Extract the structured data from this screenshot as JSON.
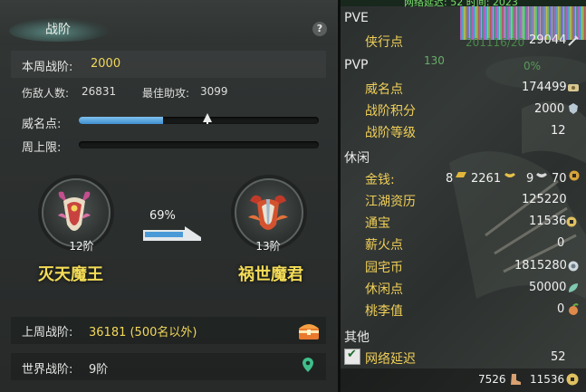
{
  "left_panel": {
    "title": "战阶",
    "help": "?",
    "week_rank_label": "本周战阶:",
    "week_rank_value": "2000",
    "kills_label": "伤敌人数:",
    "kills_value": "26831",
    "assist_label": "最佳助攻:",
    "assist_value": "3099",
    "fame_label": "威名点:",
    "fame_progress": 0.35,
    "weekly_cap_label": "周上限:",
    "weekly_cap_progress": 0,
    "current_tier": "12阶",
    "current_name": "灭天魔王",
    "next_tier": "13阶",
    "next_name": "祸世魔君",
    "progress_percent": "69%",
    "last_week_label": "上周战阶:",
    "last_week_value": "36181 (500名以外)",
    "world_label": "世界战阶:",
    "world_value": "9阶"
  },
  "right_panel": {
    "top_cut_text": "网络延迟: 52   时间: 2023",
    "bg_text_1": "201116/20",
    "bg_text_2": "130",
    "bg_text_3": "0%",
    "sections": {
      "pve": "PVE",
      "pvp": "PVP",
      "leisure": "休闲",
      "other": "其他"
    },
    "pve": [
      {
        "label": "侠行点",
        "value": "29044"
      }
    ],
    "pvp": [
      {
        "label": "威名点",
        "value": "174499"
      },
      {
        "label": "战阶积分",
        "value": "2000"
      },
      {
        "label": "战阶等级",
        "value": "12"
      }
    ],
    "money": {
      "label": "金钱:",
      "gold_bars": "8",
      "gold": "2261",
      "silver": "9",
      "copper": "70"
    },
    "leisure": [
      {
        "label": "江湖资历",
        "value": "125220"
      },
      {
        "label": "通宝",
        "value": "11536"
      },
      {
        "label": "薪火点",
        "value": "0"
      },
      {
        "label": "园宅币",
        "value": "1815280"
      },
      {
        "label": "休闲点",
        "value": "50000"
      },
      {
        "label": "桃李值",
        "value": "0"
      }
    ],
    "other": [
      {
        "label": "网络延迟",
        "value": "52",
        "checked": true
      }
    ],
    "footer": {
      "left_value": "7526",
      "right_value": "11536"
    }
  },
  "colors": {
    "gold_text": "#f2d85a",
    "label_gold": "#f0cf58",
    "bar_blue": "#3f8fcf"
  }
}
